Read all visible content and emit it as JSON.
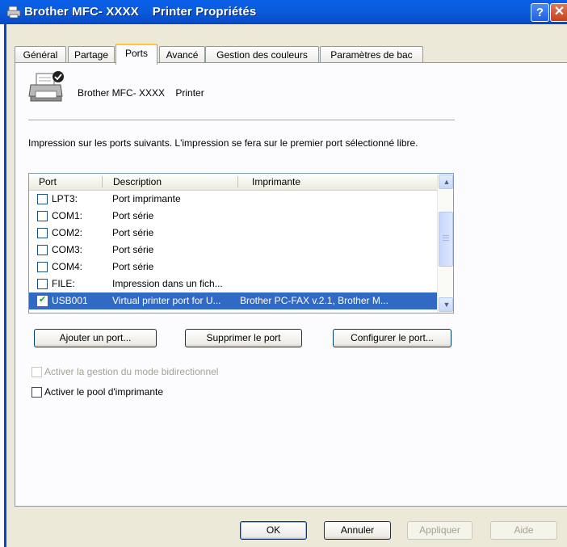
{
  "window": {
    "title": "Brother MFC- XXXX    Printer Propriétés",
    "help_glyph": "?",
    "close_glyph": "✕"
  },
  "tabs": [
    {
      "label": "Général"
    },
    {
      "label": "Partage"
    },
    {
      "label": "Ports",
      "active": true
    },
    {
      "label": "Avancé"
    },
    {
      "label": "Gestion des couleurs"
    },
    {
      "label": "Paramètres de bac"
    }
  ],
  "printer_name": "Brother MFC- XXXX    Printer",
  "info_text": "Impression sur les ports suivants. L'impression se fera sur le premier port sélectionné libre.",
  "port_list": {
    "columns": [
      "Port",
      "Description",
      "Imprimante"
    ],
    "rows": [
      {
        "port": "LPT3:",
        "description": "Port imprimante",
        "printer": "",
        "checked": false,
        "selected": false
      },
      {
        "port": "COM1:",
        "description": "Port série",
        "printer": "",
        "checked": false,
        "selected": false
      },
      {
        "port": "COM2:",
        "description": "Port série",
        "printer": "",
        "checked": false,
        "selected": false
      },
      {
        "port": "COM3:",
        "description": "Port série",
        "printer": "",
        "checked": false,
        "selected": false
      },
      {
        "port": "COM4:",
        "description": "Port série",
        "printer": "",
        "checked": false,
        "selected": false
      },
      {
        "port": "FILE:",
        "description": "Impression dans un fich...",
        "printer": "",
        "checked": false,
        "selected": false
      },
      {
        "port": "USB001",
        "description": "Virtual printer port for U...",
        "printer": "Brother PC-FAX v.2.1, Brother M...",
        "checked": true,
        "selected": true
      }
    ]
  },
  "port_buttons": {
    "add": "Ajouter un port...",
    "delete": "Supprimer le port",
    "configure": "Configurer le port..."
  },
  "options": {
    "bidirectional": {
      "label": "Activer la gestion du mode bidirectionnel",
      "checked": false,
      "enabled": false
    },
    "pooling": {
      "label": "Activer le pool d'imprimante",
      "checked": false,
      "enabled": true
    }
  },
  "footer": {
    "ok": "OK",
    "cancel": "Annuler",
    "apply": "Appliquer",
    "help": "Aide"
  },
  "colors": {
    "titlebar": "#0a5fe8",
    "dialog_bg": "#ece9d8",
    "selection": "#316ac5",
    "tab_highlight": "#ffc83c"
  }
}
